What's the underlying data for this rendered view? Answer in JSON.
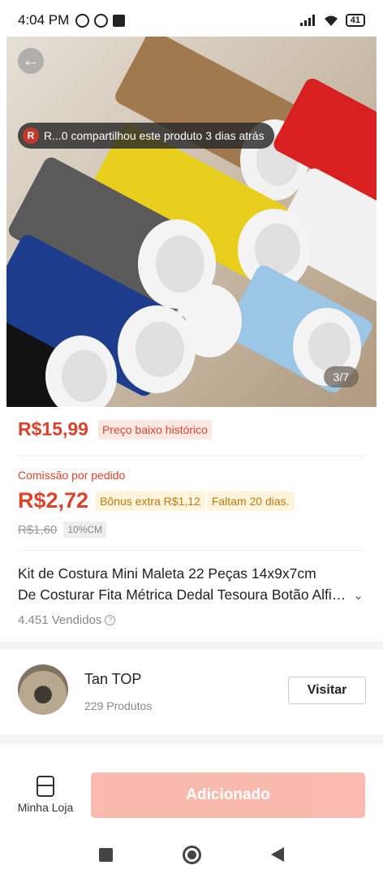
{
  "status_bar": {
    "time": "4:04 PM",
    "battery": "41"
  },
  "hero": {
    "share_avatar_letter": "R",
    "share_text": "R...0 compartilhou este produto 3 dias atrás",
    "image_counter": "3/7"
  },
  "price": {
    "main": "R$15,99",
    "tag": "Preço baixo histórico"
  },
  "commission": {
    "label": "Comissão por pedido",
    "value": "R$2,72",
    "bonus": "Bônus extra R$1,12",
    "faltam": "Faltam 20 dias.",
    "old_price": "R$1,60",
    "percent_tag": "10%CM"
  },
  "product": {
    "title_line1": "Kit de Costura Mini Maleta 22 Peças 14x9x7cm",
    "title_line2": "De Costurar Fita Métrica Dedal Tesoura Botão Alfinete",
    "sold": "4.451 Vendidos"
  },
  "store": {
    "name": "Tan TOP",
    "count": "229 Produtos",
    "visit_label": "Visitar"
  },
  "bottom": {
    "myshop_label": "Minha Loja",
    "add_label": "Adicionado"
  },
  "colors": {
    "accent": "#d9442b",
    "add_button": "#f9b3a6",
    "bonus_text": "#c07a10"
  }
}
